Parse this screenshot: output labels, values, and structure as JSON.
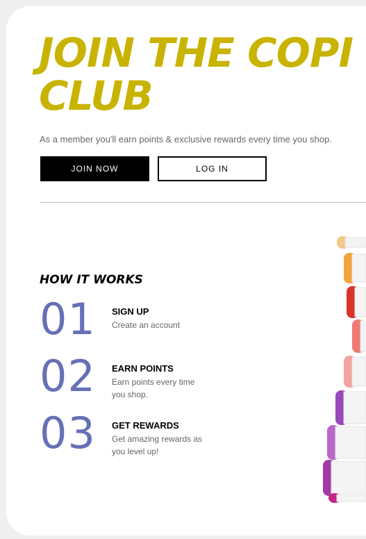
{
  "title_line1": "JOIN THE COPI",
  "title_line2": "CLUB",
  "intro": "As a member you'll earn points & exclusive rewards every time you shop.",
  "buttons": {
    "join": "JOIN NOW",
    "login": "LOG IN"
  },
  "how_it_works": {
    "heading": "HOW IT WORKS",
    "steps": [
      {
        "number": "01",
        "title": "SIGN UP",
        "desc": "Create an account"
      },
      {
        "number": "02",
        "title": "EARN POINTS",
        "desc": "Earn points every time you shop."
      },
      {
        "number": "03",
        "title": "GET REWARDS",
        "desc": "Get amazing rewards as you level up!"
      }
    ]
  },
  "colors": {
    "title": "#c8b400",
    "numbers": "#6670b5",
    "lipsticks": [
      "#f3c98a",
      "#f2a33a",
      "#d9322a",
      "#ee7b73",
      "#f3a3a0",
      "#9a49b8",
      "#b967c7",
      "#a43aa5",
      "#c2268a"
    ]
  }
}
